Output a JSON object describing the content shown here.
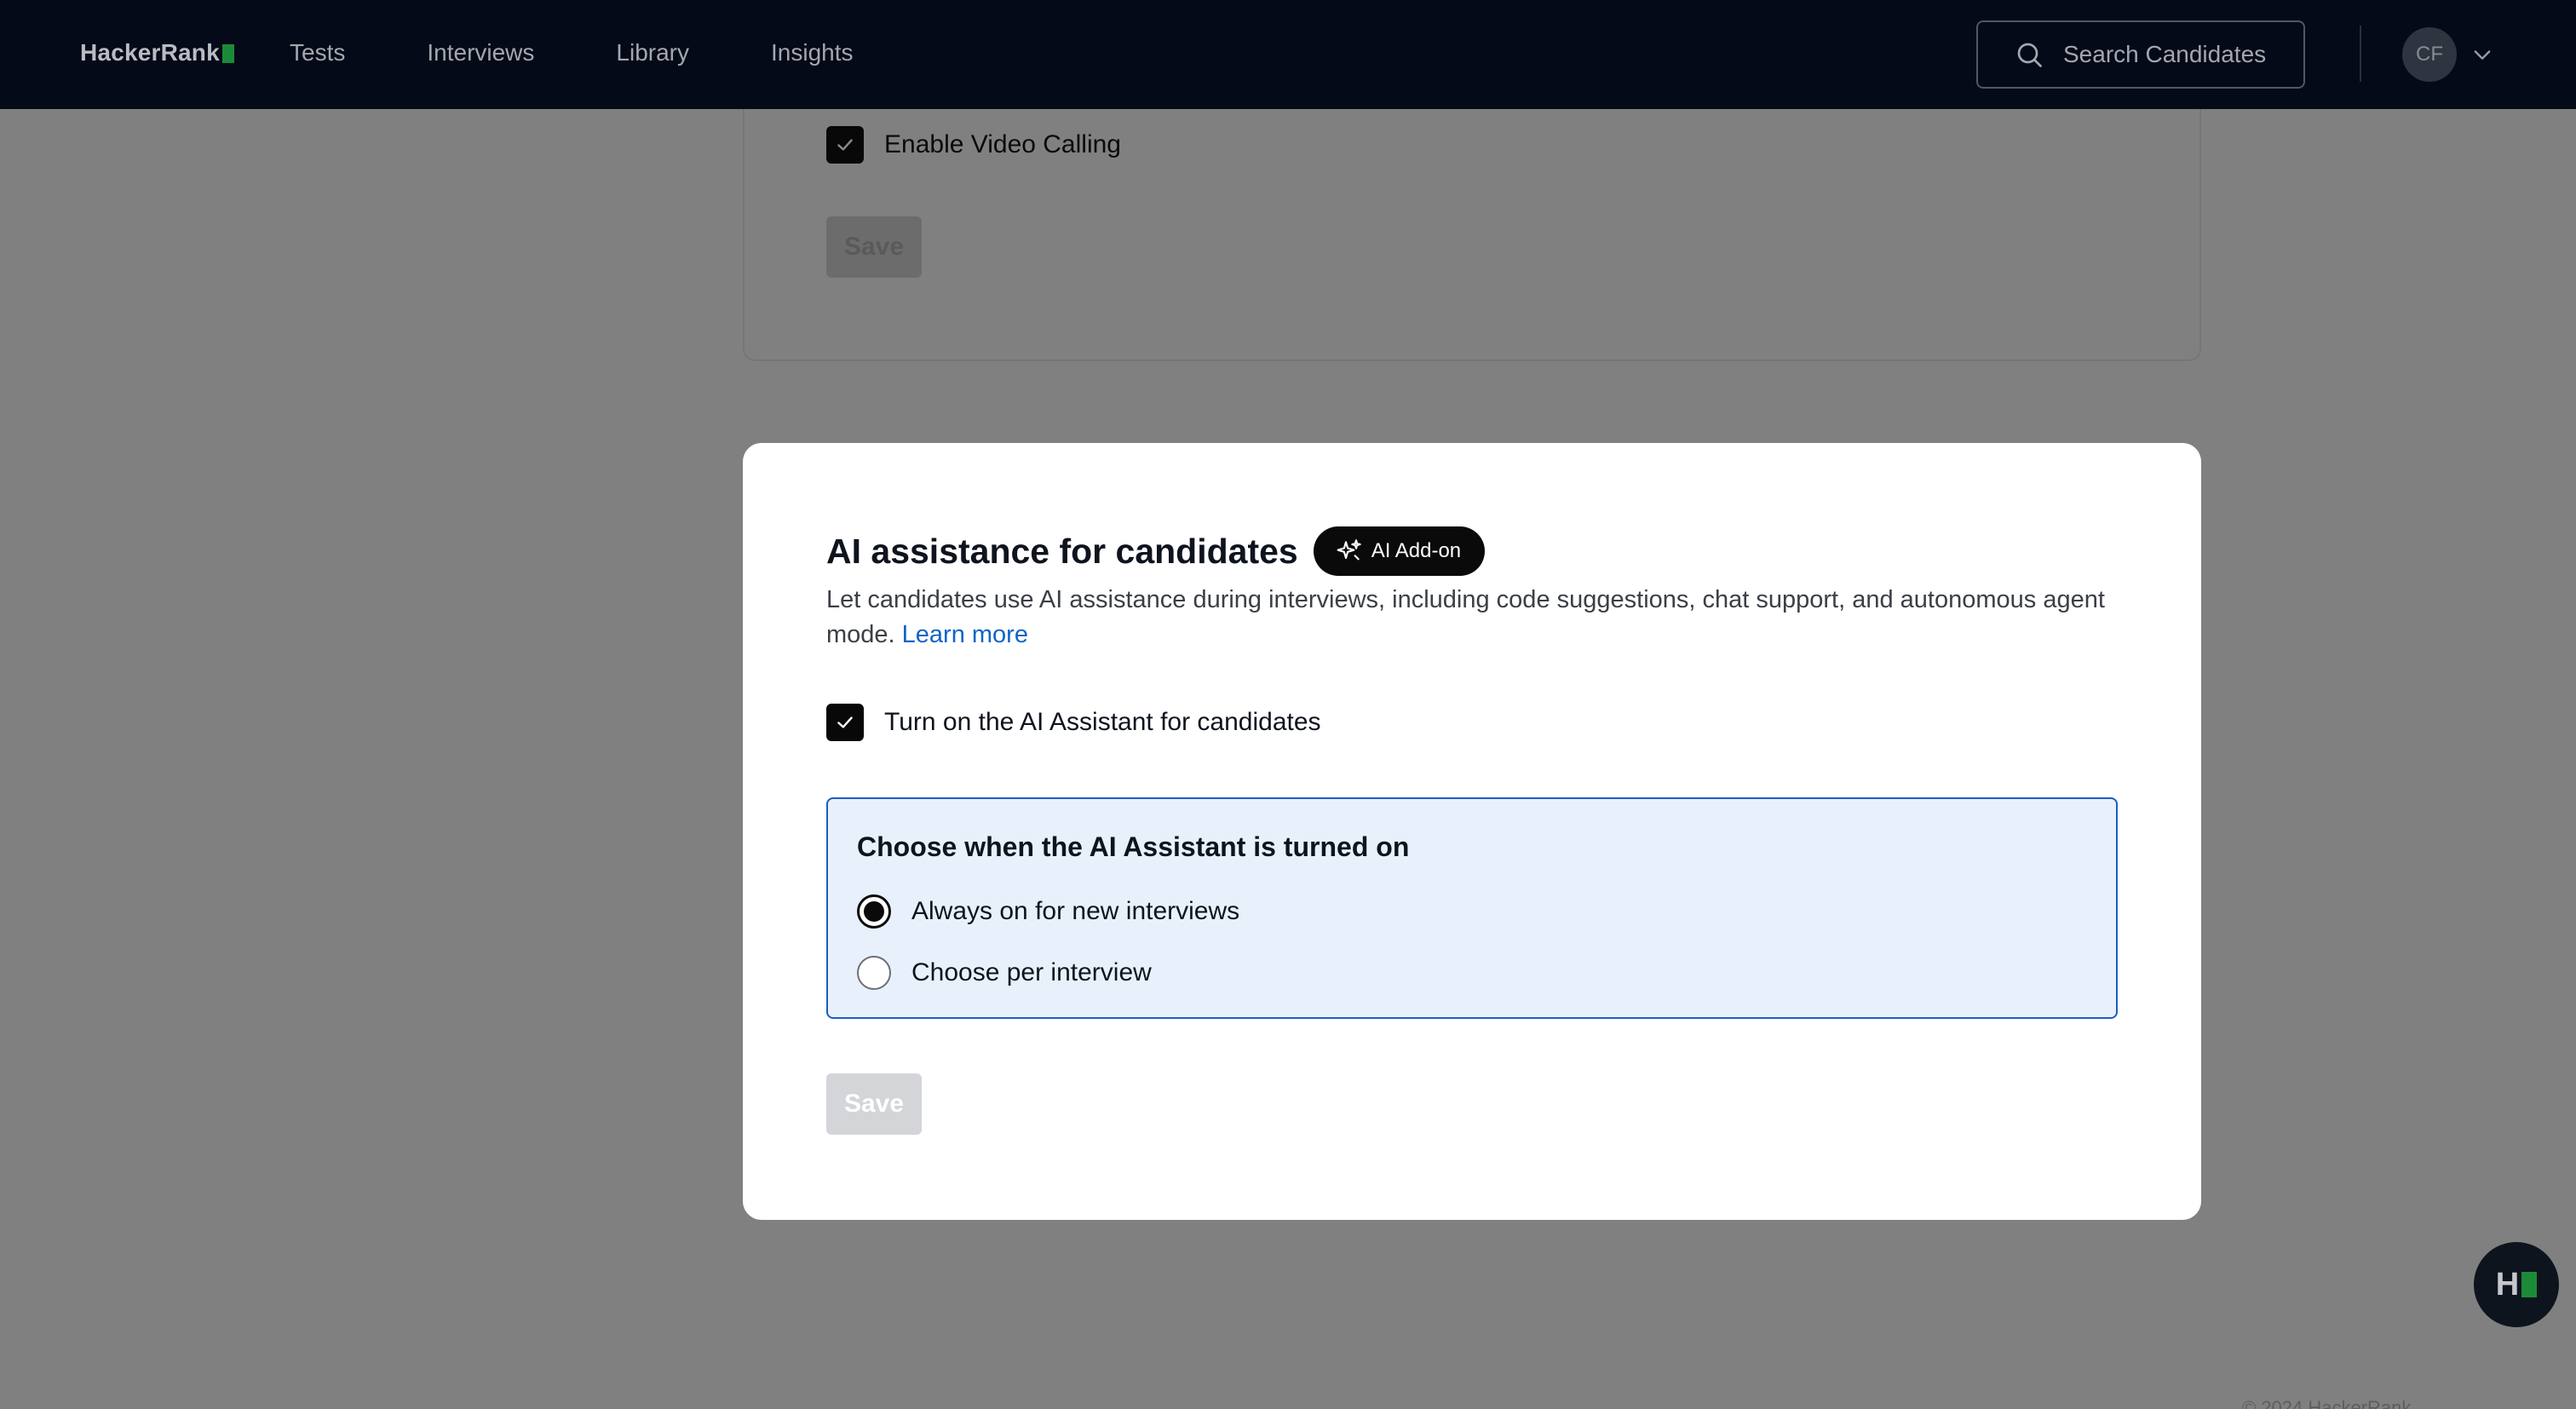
{
  "nav": {
    "logo_text": "HackerRank",
    "links": [
      {
        "label": "Tests"
      },
      {
        "label": "Interviews"
      },
      {
        "label": "Library"
      },
      {
        "label": "Insights"
      }
    ],
    "search_placeholder": "Search Candidates",
    "avatar_initials": "CF"
  },
  "background_card": {
    "checkbox_label": "Enable Video Calling",
    "checkbox_checked": true,
    "save_label": "Save"
  },
  "modal": {
    "title": "AI assistance for candidates",
    "badge": "AI Add-on",
    "description": "Let candidates use AI assistance during interviews, including code suggestions, chat support, and autonomous agent mode.",
    "learn_more": "Learn more",
    "checkbox_label": "Turn on the AI Assistant for candidates",
    "checkbox_checked": true,
    "choice": {
      "title": "Choose when the AI Assistant is turned on",
      "options": [
        {
          "label": "Always on for new interviews",
          "selected": true
        },
        {
          "label": "Choose per interview",
          "selected": false
        }
      ]
    },
    "save_label": "Save"
  },
  "help": {
    "letter": "H"
  },
  "footer": {
    "text": "© 2024 HackerRank"
  },
  "colors": {
    "nav_bg": "#050a18",
    "overlay": "#808080",
    "accent_blue": "#1b5ec3",
    "link_blue": "#0f64c7",
    "brand_green": "#1c8b39"
  }
}
